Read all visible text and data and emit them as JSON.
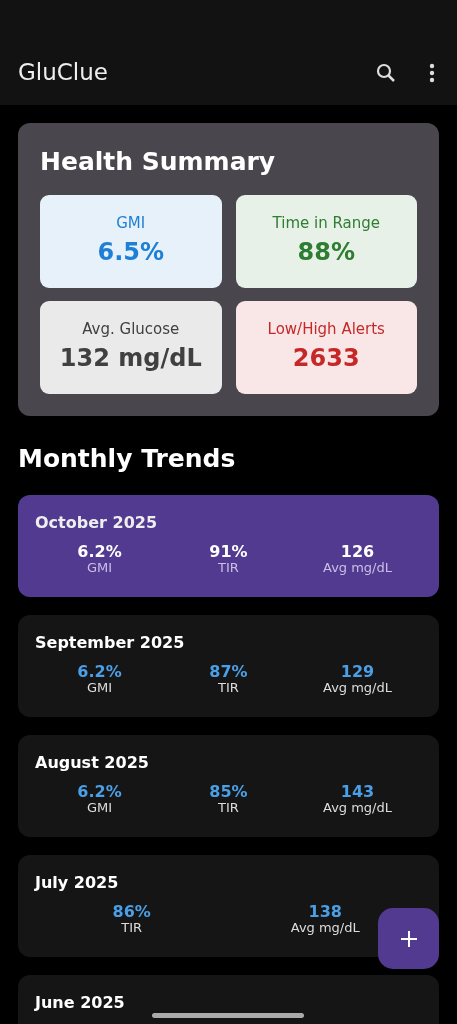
{
  "app_bar": {
    "title": "GluClue"
  },
  "summary": {
    "title": "Health Summary",
    "tiles": [
      {
        "label": "GMI",
        "value": "6.5%",
        "color": "#1e7fd6"
      },
      {
        "label": "Time in Range",
        "value": "88%",
        "color": "#2e7d32"
      },
      {
        "label": "Avg. Glucose",
        "value": "132 mg/dL",
        "color": "#404040"
      },
      {
        "label": "Low/High Alerts",
        "value": "2633",
        "color": "#c62828"
      }
    ]
  },
  "trends": {
    "title": "Monthly Trends",
    "months": [
      {
        "title": "October 2025",
        "selected": true,
        "metrics": [
          {
            "value": "6.2%",
            "label": "GMI"
          },
          {
            "value": "91%",
            "label": "TIR"
          },
          {
            "value": "126",
            "label": "Avg mg/dL"
          }
        ]
      },
      {
        "title": "September 2025",
        "selected": false,
        "metrics": [
          {
            "value": "6.2%",
            "label": "GMI"
          },
          {
            "value": "87%",
            "label": "TIR"
          },
          {
            "value": "129",
            "label": "Avg mg/dL"
          }
        ]
      },
      {
        "title": "August 2025",
        "selected": false,
        "metrics": [
          {
            "value": "6.2%",
            "label": "GMI"
          },
          {
            "value": "85%",
            "label": "TIR"
          },
          {
            "value": "143",
            "label": "Avg mg/dL"
          }
        ]
      },
      {
        "title": "July 2025",
        "selected": false,
        "metrics": [
          {
            "value": "86%",
            "label": "TIR"
          },
          {
            "value": "138",
            "label": "Avg mg/dL"
          }
        ]
      },
      {
        "title": "June 2025",
        "selected": false
      }
    ]
  }
}
